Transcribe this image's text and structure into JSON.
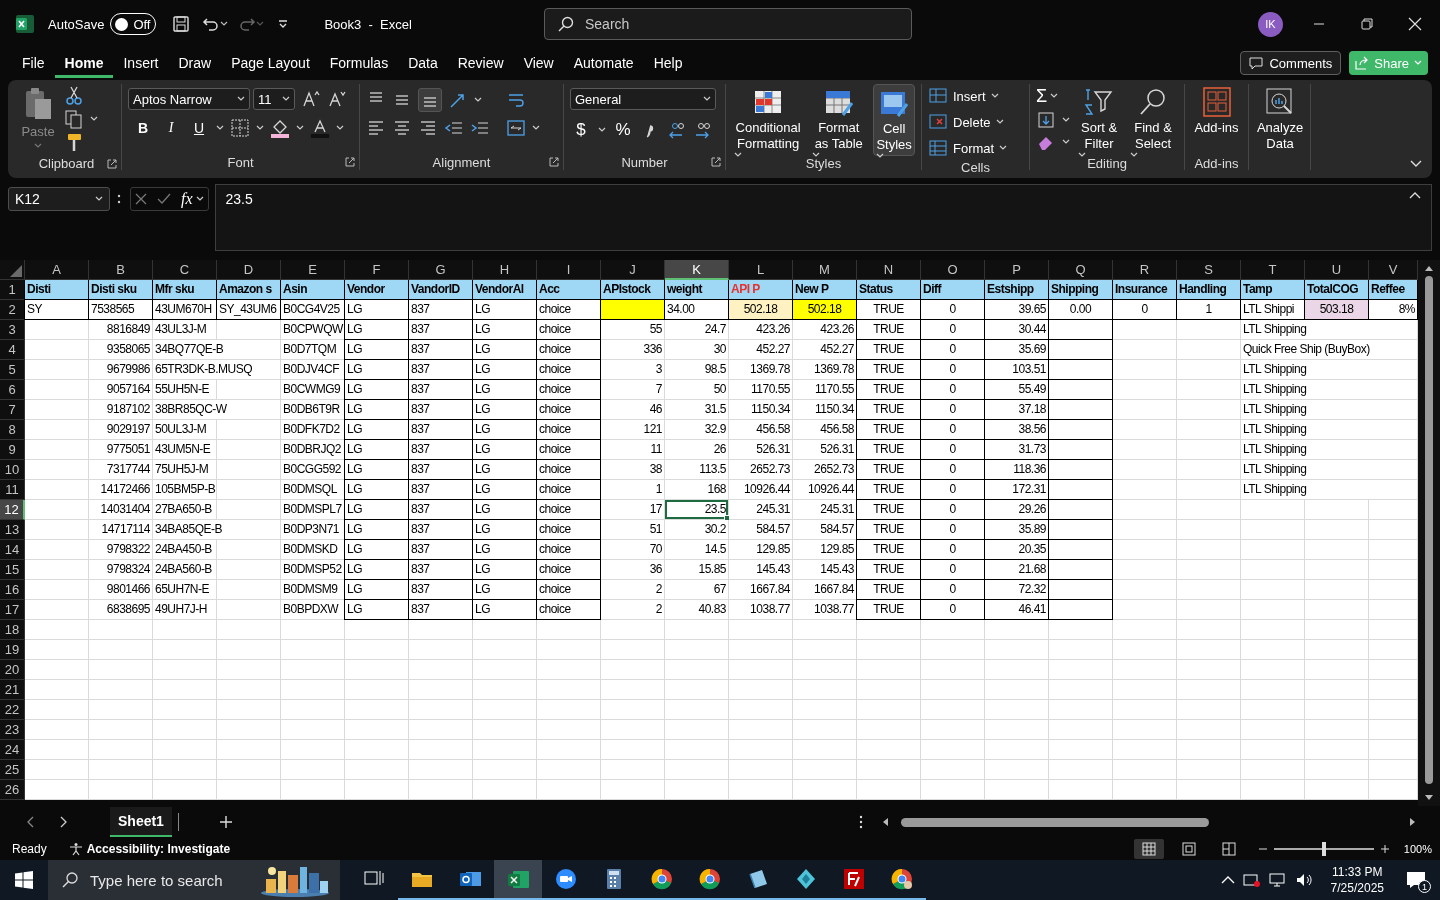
{
  "title_bar": {
    "autosave_label": "AutoSave",
    "autosave_on": false,
    "autosave_state": "Off",
    "title": "Book3  -  Excel",
    "search_placeholder": "Search",
    "avatar": "IK"
  },
  "menu_tabs": [
    {
      "label": "File",
      "selected": false
    },
    {
      "label": "Home",
      "selected": true
    },
    {
      "label": "Insert",
      "selected": false
    },
    {
      "label": "Draw",
      "selected": false
    },
    {
      "label": "Page Layout",
      "selected": false
    },
    {
      "label": "Formulas",
      "selected": false
    },
    {
      "label": "Data",
      "selected": false
    },
    {
      "label": "Review",
      "selected": false
    },
    {
      "label": "View",
      "selected": false
    },
    {
      "label": "Automate",
      "selected": false
    },
    {
      "label": "Help",
      "selected": false
    }
  ],
  "comments_button": "Comments",
  "share_button": "Share",
  "ribbon": {
    "clipboard": {
      "paste": "Paste",
      "paste_disabled": true,
      "label": "Clipboard"
    },
    "font": {
      "font_name": "Aptos Narrow",
      "font_size": "11",
      "bold": "B",
      "italic": "I",
      "underline": "U",
      "label": "Font"
    },
    "alignment": {
      "label": "Alignment",
      "bottom_align_selected": true
    },
    "number": {
      "format": "General",
      "currency": "$",
      "percent": "%",
      "label": "Number"
    },
    "styles": {
      "buttons": [
        {
          "label": "Conditional Formatting",
          "selected": false
        },
        {
          "label": "Format as Table",
          "selected": false
        },
        {
          "label": "Cell Styles",
          "selected": true
        }
      ],
      "label": "Styles"
    },
    "cells": {
      "buttons": [
        "Insert",
        "Delete",
        "Format"
      ],
      "label": "Cells"
    },
    "editing": {
      "autosum": "Σ",
      "sort": "Sort & Filter",
      "find": "Find & Select",
      "label": "Editing"
    },
    "addins": {
      "button": "Add-ins",
      "label": "Add-ins"
    },
    "analyze": {
      "button": "Analyze Data"
    }
  },
  "formula_bar": {
    "name_box": "K12",
    "function_label": "fx",
    "formula": "23.5"
  },
  "sheet": {
    "columns": [
      {
        "label": "A",
        "selected": false
      },
      {
        "label": "B",
        "selected": false
      },
      {
        "label": "C",
        "selected": false
      },
      {
        "label": "D",
        "selected": false
      },
      {
        "label": "E",
        "selected": false
      },
      {
        "label": "F",
        "selected": false
      },
      {
        "label": "G",
        "selected": false
      },
      {
        "label": "H",
        "selected": false
      },
      {
        "label": "I",
        "selected": false
      },
      {
        "label": "J",
        "selected": false
      },
      {
        "label": "K",
        "selected": true
      },
      {
        "label": "L",
        "selected": false
      },
      {
        "label": "M",
        "selected": false
      },
      {
        "label": "N",
        "selected": false
      },
      {
        "label": "O",
        "selected": false
      },
      {
        "label": "P",
        "selected": false
      },
      {
        "label": "Q",
        "selected": false
      },
      {
        "label": "R",
        "selected": false
      },
      {
        "label": "S",
        "selected": false
      },
      {
        "label": "T",
        "selected": false
      },
      {
        "label": "U",
        "selected": false
      },
      {
        "label": "V",
        "selected": false
      }
    ],
    "rows": [
      {
        "number": "1",
        "selected": false,
        "color": "#9ed8f5",
        "cells": [
          {
            "text": "Disti",
            "flagged": false
          },
          {
            "text": "Disti sku",
            "flagged": false
          },
          {
            "text": "Mfr sku",
            "flagged": false
          },
          {
            "text": "Amazon s",
            "flagged": false
          },
          {
            "text": "Asin",
            "flagged": false
          },
          {
            "text": "Vendor",
            "flagged": false
          },
          {
            "text": "VandorID",
            "flagged": false
          },
          {
            "text": "VendorAl",
            "flagged": false
          },
          {
            "text": "Acc",
            "flagged": false
          },
          {
            "text": "APIstock",
            "flagged": false
          },
          {
            "text": "weight",
            "flagged": false
          },
          {
            "text": "API P",
            "flagged": true
          },
          {
            "text": "New P",
            "flagged": false
          },
          {
            "text": "Status",
            "flagged": false
          },
          {
            "text": "Diff",
            "flagged": false
          },
          {
            "text": "Estshipp",
            "flagged": false
          },
          {
            "text": "Shipping",
            "flagged": false
          },
          {
            "text": "Insurance",
            "flagged": false
          },
          {
            "text": "Handling",
            "flagged": false
          },
          {
            "text": "Tamp",
            "flagged": false
          },
          {
            "text": "TotalCOG",
            "flagged": false
          },
          {
            "text": "Reffee",
            "flagged": false
          }
        ]
      },
      {
        "number": "2",
        "selected": false,
        "cells": [
          {
            "text": "SY"
          },
          {
            "text": "7538565"
          },
          {
            "text": "43UM670H"
          },
          {
            "text": "SY_43UM6"
          },
          {
            "text": "B0CG4V25"
          },
          {
            "text": "LG"
          },
          {
            "text": "837"
          },
          {
            "text": "LG"
          },
          {
            "text": "choice"
          },
          {
            "color": "#ffff00"
          },
          {
            "text": "34.00"
          },
          {
            "text": "502.18",
            "color": "#fff2c2"
          },
          {
            "text": "502.18",
            "color": "#ffff00"
          },
          {
            "text": "TRUE"
          },
          {
            "text": "0"
          },
          {
            "text": "39.65"
          },
          {
            "text": "0.00"
          },
          {
            "text": "0"
          },
          {
            "text": "1"
          },
          {
            "text": "LTL Shippi"
          },
          {
            "text": "503.18",
            "color": "#ead6e6"
          },
          {
            "text": "8%"
          }
        ]
      },
      {
        "number": "3",
        "selected": false,
        "cells": [
          {},
          {
            "text": "8816849"
          },
          {
            "text": "43UL3J-M"
          },
          {},
          {
            "text": "B0CPWQW"
          },
          {
            "text": "LG"
          },
          {
            "text": "837"
          },
          {
            "text": "LG"
          },
          {
            "text": "choice"
          },
          {
            "text": "55"
          },
          {
            "text": "24.7"
          },
          {
            "text": "423.26"
          },
          {
            "text": "423.26"
          },
          {
            "text": "TRUE"
          },
          {
            "text": "0"
          },
          {
            "text": "30.44"
          },
          {},
          {},
          {},
          {
            "text": "LTL Shipping"
          }
        ]
      },
      {
        "number": "4",
        "selected": false,
        "cells": [
          {},
          {
            "text": "9358065"
          },
          {
            "text": "34BQ77QE-B"
          },
          {},
          {
            "text": "B0D7TQM"
          },
          {
            "text": "LG"
          },
          {
            "text": "837"
          },
          {
            "text": "LG"
          },
          {
            "text": "choice"
          },
          {
            "text": "336"
          },
          {
            "text": "30"
          },
          {
            "text": "452.27"
          },
          {
            "text": "452.27"
          },
          {
            "text": "TRUE"
          },
          {
            "text": "0"
          },
          {
            "text": "35.69"
          },
          {},
          {},
          {},
          {
            "text": "Quick Free Ship (BuyBox)"
          }
        ]
      },
      {
        "number": "5",
        "selected": false,
        "cells": [
          {},
          {
            "text": "9679986"
          },
          {
            "text": "65TR3DK-B.MUSQ"
          },
          {},
          {
            "text": "B0DJV4CF"
          },
          {
            "text": "LG"
          },
          {
            "text": "837"
          },
          {
            "text": "LG"
          },
          {
            "text": "choice"
          },
          {
            "text": "3"
          },
          {
            "text": "98.5"
          },
          {
            "text": "1369.78"
          },
          {
            "text": "1369.78"
          },
          {
            "text": "TRUE"
          },
          {
            "text": "0"
          },
          {
            "text": "103.51"
          },
          {},
          {},
          {},
          {
            "text": "LTL Shipping"
          }
        ]
      },
      {
        "number": "6",
        "selected": false,
        "cells": [
          {},
          {
            "text": "9057164"
          },
          {
            "text": "55UH5N-E"
          },
          {},
          {
            "text": "B0CWMG9"
          },
          {
            "text": "LG"
          },
          {
            "text": "837"
          },
          {
            "text": "LG"
          },
          {
            "text": "choice"
          },
          {
            "text": "7"
          },
          {
            "text": "50"
          },
          {
            "text": "1170.55"
          },
          {
            "text": "1170.55"
          },
          {
            "text": "TRUE"
          },
          {
            "text": "0"
          },
          {
            "text": "55.49"
          },
          {},
          {},
          {},
          {
            "text": "LTL Shipping"
          }
        ]
      },
      {
        "number": "7",
        "selected": false,
        "cells": [
          {},
          {
            "text": "9187102"
          },
          {
            "text": "38BR85QC-W"
          },
          {},
          {
            "text": "B0DB6T9R"
          },
          {
            "text": "LG"
          },
          {
            "text": "837"
          },
          {
            "text": "LG"
          },
          {
            "text": "choice"
          },
          {
            "text": "46"
          },
          {
            "text": "31.5"
          },
          {
            "text": "1150.34"
          },
          {
            "text": "1150.34"
          },
          {
            "text": "TRUE"
          },
          {
            "text": "0"
          },
          {
            "text": "37.18"
          },
          {},
          {},
          {},
          {
            "text": "LTL Shipping"
          }
        ]
      },
      {
        "number": "8",
        "selected": false,
        "cells": [
          {},
          {
            "text": "9029197"
          },
          {
            "text": "50UL3J-M"
          },
          {},
          {
            "text": "B0DFK7D2"
          },
          {
            "text": "LG"
          },
          {
            "text": "837"
          },
          {
            "text": "LG"
          },
          {
            "text": "choice"
          },
          {
            "text": "121"
          },
          {
            "text": "32.9"
          },
          {
            "text": "456.58"
          },
          {
            "text": "456.58"
          },
          {
            "text": "TRUE"
          },
          {
            "text": "0"
          },
          {
            "text": "38.56"
          },
          {},
          {},
          {},
          {
            "text": "LTL Shipping"
          }
        ]
      },
      {
        "number": "9",
        "selected": false,
        "cells": [
          {},
          {
            "text": "9775051"
          },
          {
            "text": "43UM5N-E"
          },
          {},
          {
            "text": "B0DBRJQ2"
          },
          {
            "text": "LG"
          },
          {
            "text": "837"
          },
          {
            "text": "LG"
          },
          {
            "text": "choice"
          },
          {
            "text": "11"
          },
          {
            "text": "26"
          },
          {
            "text": "526.31"
          },
          {
            "text": "526.31"
          },
          {
            "text": "TRUE"
          },
          {
            "text": "0"
          },
          {
            "text": "31.73"
          },
          {},
          {},
          {},
          {
            "text": "LTL Shipping"
          }
        ]
      },
      {
        "number": "10",
        "selected": false,
        "cells": [
          {},
          {
            "text": "7317744"
          },
          {
            "text": "75UH5J-M"
          },
          {},
          {
            "text": "B0CGG592"
          },
          {
            "text": "LG"
          },
          {
            "text": "837"
          },
          {
            "text": "LG"
          },
          {
            "text": "choice"
          },
          {
            "text": "38"
          },
          {
            "text": "113.5"
          },
          {
            "text": "2652.73"
          },
          {
            "text": "2652.73"
          },
          {
            "text": "TRUE"
          },
          {
            "text": "0"
          },
          {
            "text": "118.36"
          },
          {},
          {},
          {},
          {
            "text": "LTL Shipping"
          }
        ]
      },
      {
        "number": "11",
        "selected": false,
        "cells": [
          {},
          {
            "text": "14172466"
          },
          {
            "text": "105BM5P-B"
          },
          {},
          {
            "text": "B0DMSQL"
          },
          {
            "text": "LG"
          },
          {
            "text": "837"
          },
          {
            "text": "LG"
          },
          {
            "text": "choice"
          },
          {
            "text": "1"
          },
          {
            "text": "168"
          },
          {
            "text": "10926.44"
          },
          {
            "text": "10926.44"
          },
          {
            "text": "TRUE"
          },
          {
            "text": "0"
          },
          {
            "text": "172.31"
          },
          {},
          {},
          {},
          {
            "text": "LTL Shipping"
          }
        ]
      },
      {
        "number": "12",
        "selected": true,
        "cells": [
          {},
          {
            "text": "14031404"
          },
          {
            "text": "27BA650-B"
          },
          {},
          {
            "text": "B0DMSPL7"
          },
          {
            "text": "LG"
          },
          {
            "text": "837"
          },
          {
            "text": "LG"
          },
          {
            "text": "choice"
          },
          {
            "text": "17"
          },
          {
            "text": "23.5"
          },
          {
            "text": "245.31"
          },
          {
            "text": "245.31"
          },
          {
            "text": "TRUE"
          },
          {
            "text": "0"
          },
          {
            "text": "29.26"
          }
        ]
      },
      {
        "number": "13",
        "selected": false,
        "cells": [
          {},
          {
            "text": "14717114"
          },
          {
            "text": "34BA85QE-B"
          },
          {},
          {
            "text": "B0DP3N71"
          },
          {
            "text": "LG"
          },
          {
            "text": "837"
          },
          {
            "text": "LG"
          },
          {
            "text": "choice"
          },
          {
            "text": "51"
          },
          {
            "text": "30.2"
          },
          {
            "text": "584.57"
          },
          {
            "text": "584.57"
          },
          {
            "text": "TRUE"
          },
          {
            "text": "0"
          },
          {
            "text": "35.89"
          }
        ]
      },
      {
        "number": "14",
        "selected": false,
        "cells": [
          {},
          {
            "text": "9798322"
          },
          {
            "text": "24BA450-B"
          },
          {},
          {
            "text": "B0DMSKD"
          },
          {
            "text": "LG"
          },
          {
            "text": "837"
          },
          {
            "text": "LG"
          },
          {
            "text": "choice"
          },
          {
            "text": "70"
          },
          {
            "text": "14.5"
          },
          {
            "text": "129.85"
          },
          {
            "text": "129.85"
          },
          {
            "text": "TRUE"
          },
          {
            "text": "0"
          },
          {
            "text": "20.35"
          }
        ]
      },
      {
        "number": "15",
        "selected": false,
        "cells": [
          {},
          {
            "text": "9798324"
          },
          {
            "text": "24BA560-B"
          },
          {},
          {
            "text": "B0DMSP52"
          },
          {
            "text": "LG"
          },
          {
            "text": "837"
          },
          {
            "text": "LG"
          },
          {
            "text": "choice"
          },
          {
            "text": "36"
          },
          {
            "text": "15.85"
          },
          {
            "text": "145.43"
          },
          {
            "text": "145.43"
          },
          {
            "text": "TRUE"
          },
          {
            "text": "0"
          },
          {
            "text": "21.68"
          }
        ]
      },
      {
        "number": "16",
        "selected": false,
        "cells": [
          {},
          {
            "text": "9801466"
          },
          {
            "text": "65UH7N-E"
          },
          {},
          {
            "text": "B0DMSM9"
          },
          {
            "text": "LG"
          },
          {
            "text": "837"
          },
          {
            "text": "LG"
          },
          {
            "text": "choice"
          },
          {
            "text": "2"
          },
          {
            "text": "67"
          },
          {
            "text": "1667.84"
          },
          {
            "text": "1667.84"
          },
          {
            "text": "TRUE"
          },
          {
            "text": "0"
          },
          {
            "text": "72.32"
          }
        ]
      },
      {
        "number": "17",
        "selected": false,
        "cells": [
          {},
          {
            "text": "6838695"
          },
          {
            "text": "49UH7J-H"
          },
          {},
          {
            "text": "B0BPDXW"
          },
          {
            "text": "LG"
          },
          {
            "text": "837"
          },
          {
            "text": "LG"
          },
          {
            "text": "choice"
          },
          {
            "text": "2"
          },
          {
            "text": "40.83"
          },
          {
            "text": "1038.77"
          },
          {
            "text": "1038.77"
          },
          {
            "text": "TRUE"
          },
          {
            "text": "0"
          },
          {
            "text": "46.41"
          }
        ]
      },
      {
        "number": "18",
        "selected": false
      },
      {
        "number": "19",
        "selected": false
      },
      {
        "number": "20",
        "selected": false
      },
      {
        "number": "21",
        "selected": false
      },
      {
        "number": "22",
        "selected": false
      },
      {
        "number": "23",
        "selected": false
      },
      {
        "number": "24",
        "selected": false
      },
      {
        "number": "25",
        "selected": false
      },
      {
        "number": "26",
        "selected": false
      }
    ]
  },
  "sheet_tabs": [
    {
      "label": "Sheet1",
      "selected": true
    }
  ],
  "status_bar": {
    "ready": "Ready",
    "accessibility": "Accessibility: Investigate",
    "zoom": "100%",
    "zoom_level": {
      "level": 0.5
    }
  },
  "taskbar": {
    "search_placeholder": "Type here to search",
    "apps": [
      {
        "selected": false
      },
      {
        "selected": false
      },
      {
        "selected": true
      },
      {
        "selected": false
      },
      {
        "selected": false
      },
      {
        "selected": false
      },
      {
        "selected": false
      },
      {
        "selected": false
      },
      {
        "selected": false
      },
      {
        "selected": false
      },
      {
        "selected": false
      }
    ],
    "time": "11:33 PM",
    "date": "7/25/2025",
    "notifications": "1"
  }
}
